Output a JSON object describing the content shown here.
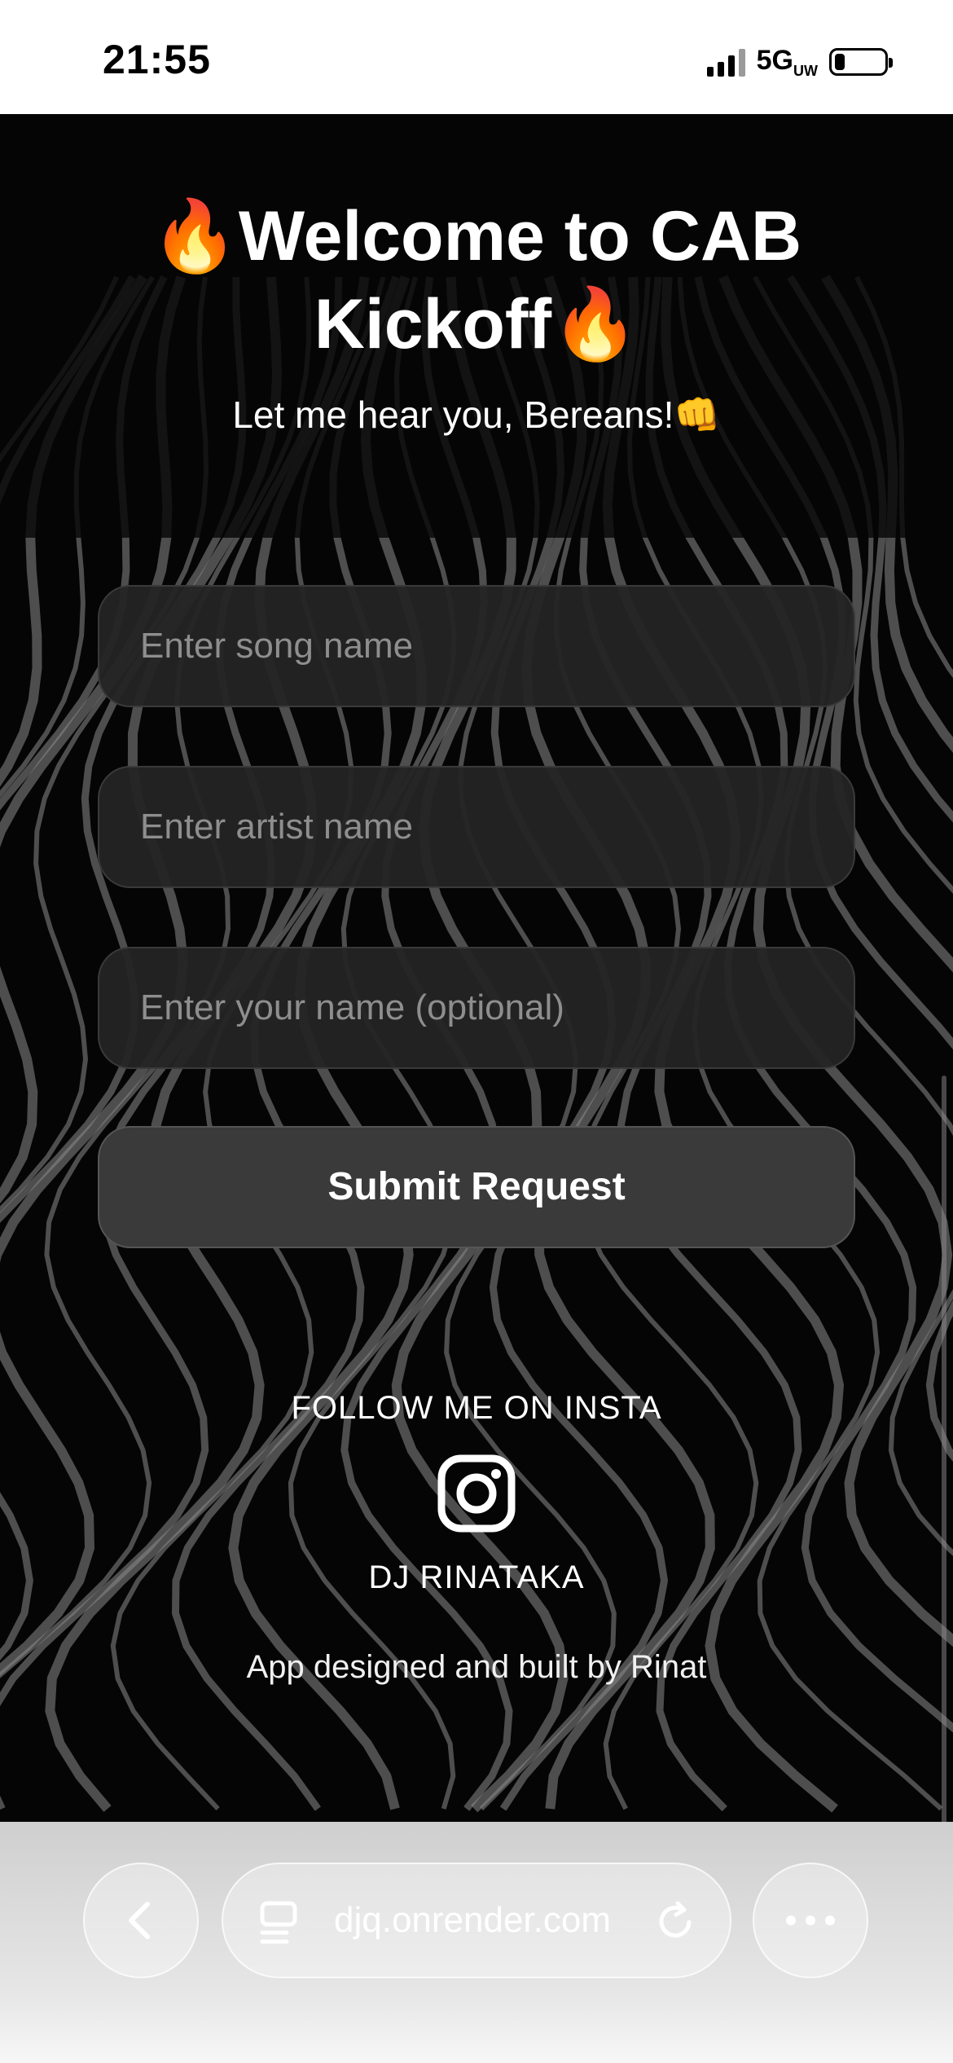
{
  "status_bar": {
    "time": "21:55",
    "network": "5G",
    "network_sub": "UW"
  },
  "hero": {
    "title": "🔥Welcome to CAB Kickoff🔥",
    "subtitle": "Let me hear you, Bereans!👊"
  },
  "form": {
    "song_placeholder": "Enter song name",
    "artist_placeholder": "Enter artist name",
    "name_placeholder": "Enter your name (optional)",
    "submit_label": "Submit Request"
  },
  "footer": {
    "follow_label": "FOLLOW ME ON INSTA",
    "handle": "DJ RINATAKA",
    "credit": "App designed and built by Rinat"
  },
  "browser": {
    "url": "djq.onrender.com"
  },
  "icons": {
    "back": "chevron-left-icon",
    "tabs": "page-menu-icon",
    "reload": "reload-icon",
    "more": "more-dots-icon",
    "instagram": "instagram-icon"
  },
  "colors": {
    "background": "#050505",
    "field": "#242424",
    "button": "#3a3a3a",
    "text": "#ffffff",
    "placeholder": "#8e8e8e"
  }
}
